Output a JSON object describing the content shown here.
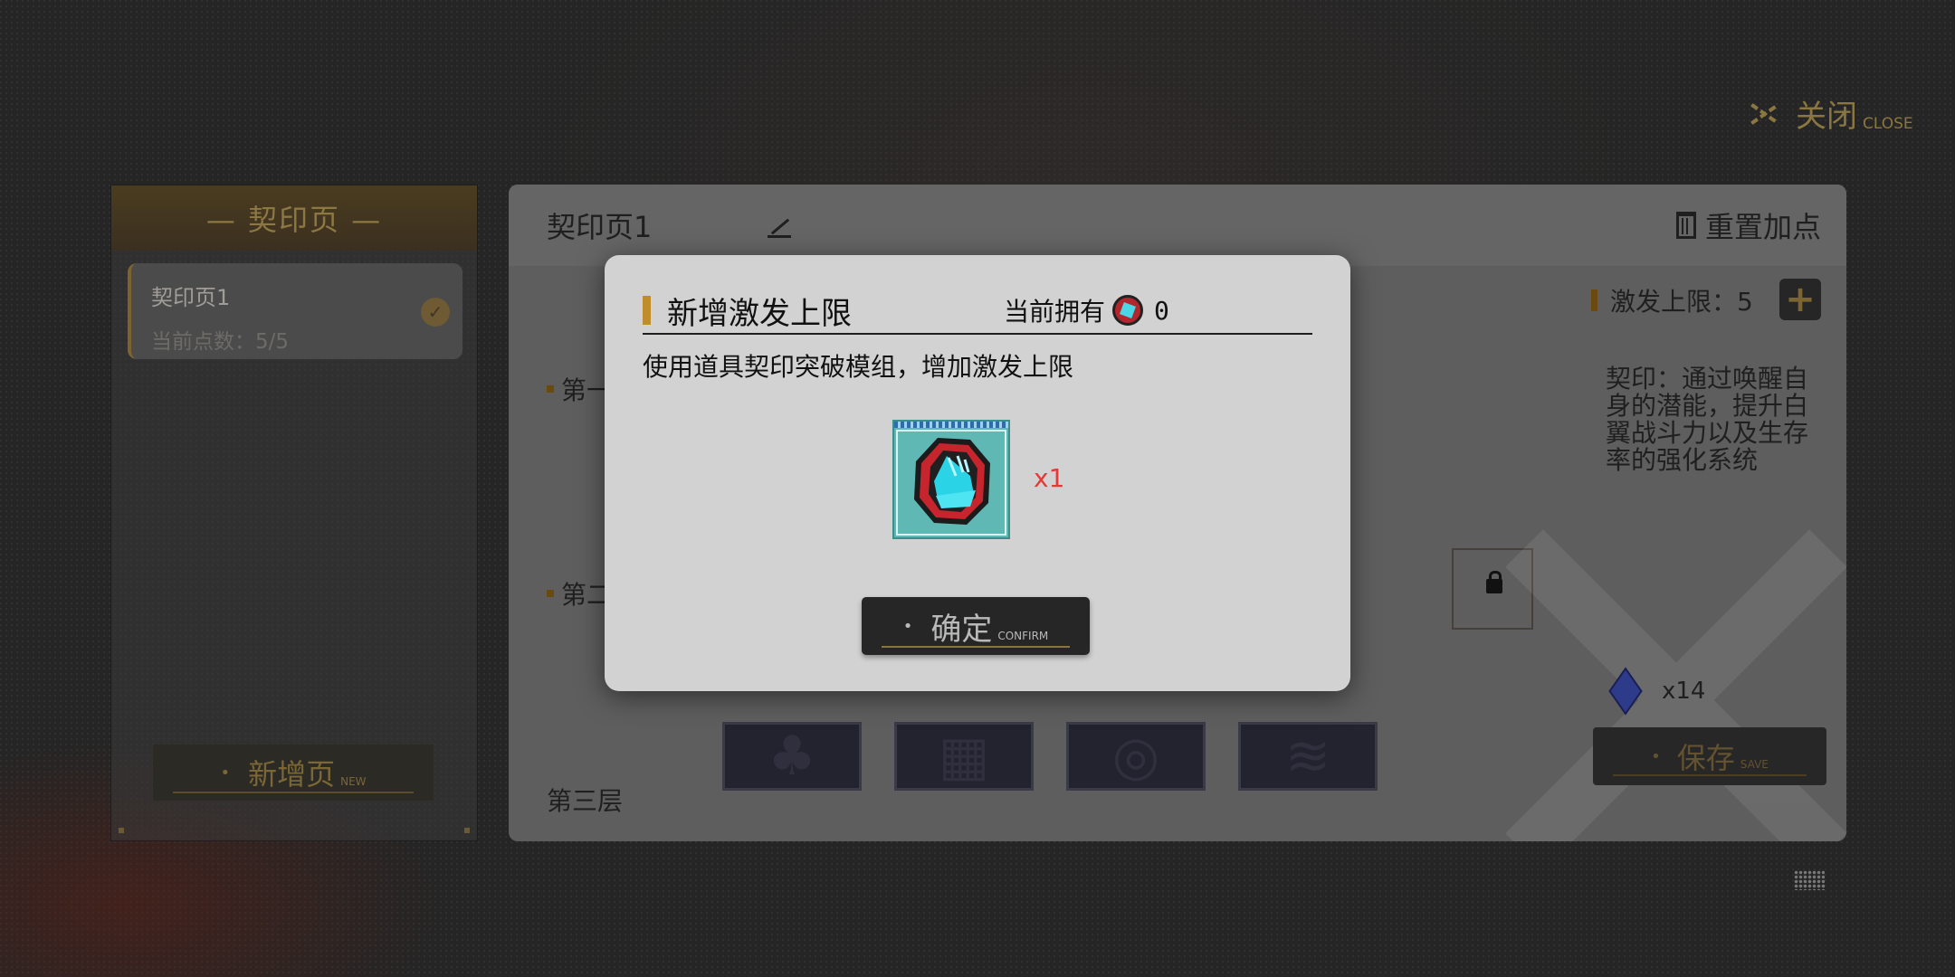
{
  "close": {
    "label": "关闭",
    "sub": "CLOSE"
  },
  "left_panel": {
    "header": "— 契印页 —",
    "page_card": {
      "name": "契印页1",
      "points": "当前点数：5/5",
      "selected": true
    },
    "new_page": {
      "label": "新增页",
      "sub": "NEW"
    }
  },
  "main_panel": {
    "page_title": "契印页1",
    "reset_label": "重置加点",
    "rows": [
      "第一",
      "第二",
      "第三层"
    ],
    "limit_label": "激发上限：5",
    "description": "契印：通过唤醒自身的潜能，提升白翼战斗力以及生存率的强化系统",
    "material_count": "x14",
    "save": {
      "label": "保存",
      "sub": "SAVE"
    }
  },
  "dialog": {
    "title": "新增激发上限",
    "owned_label": "当前拥有",
    "owned_count": "0",
    "subtitle": "使用道具契印突破模组，增加激发上限",
    "item_quantity": "x1",
    "confirm": {
      "label": "确定",
      "sub": "CONFIRM"
    }
  },
  "colors": {
    "accent": "#c08d2b",
    "quantity": "#e53935",
    "item_bg": "#5fb8b4"
  },
  "icons": [
    "close-icon",
    "check-icon",
    "edit-icon",
    "trash-icon",
    "plus-icon",
    "lock-icon",
    "gem-icon",
    "seal-module-icon",
    "grid-icon"
  ]
}
